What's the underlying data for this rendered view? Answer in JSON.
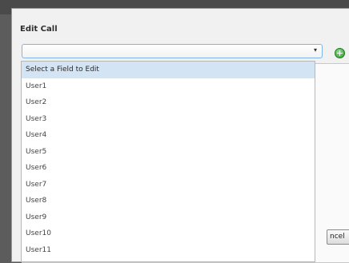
{
  "dialog": {
    "title": "Edit Call",
    "cancel_label": "ncel"
  },
  "field_select": {
    "selected": "",
    "arrow": "▾",
    "options": [
      "Select a Field to Edit",
      "User1",
      "User2",
      "User3",
      "User4",
      "User5",
      "User6",
      "User7",
      "User8",
      "User9",
      "User10",
      "User11"
    ]
  },
  "icons": {
    "add": "add-circle-icon"
  },
  "colors": {
    "highlight": "#d3e4f5",
    "select_border": "#7eb4ea",
    "add_icon": "#2d9a2d"
  }
}
